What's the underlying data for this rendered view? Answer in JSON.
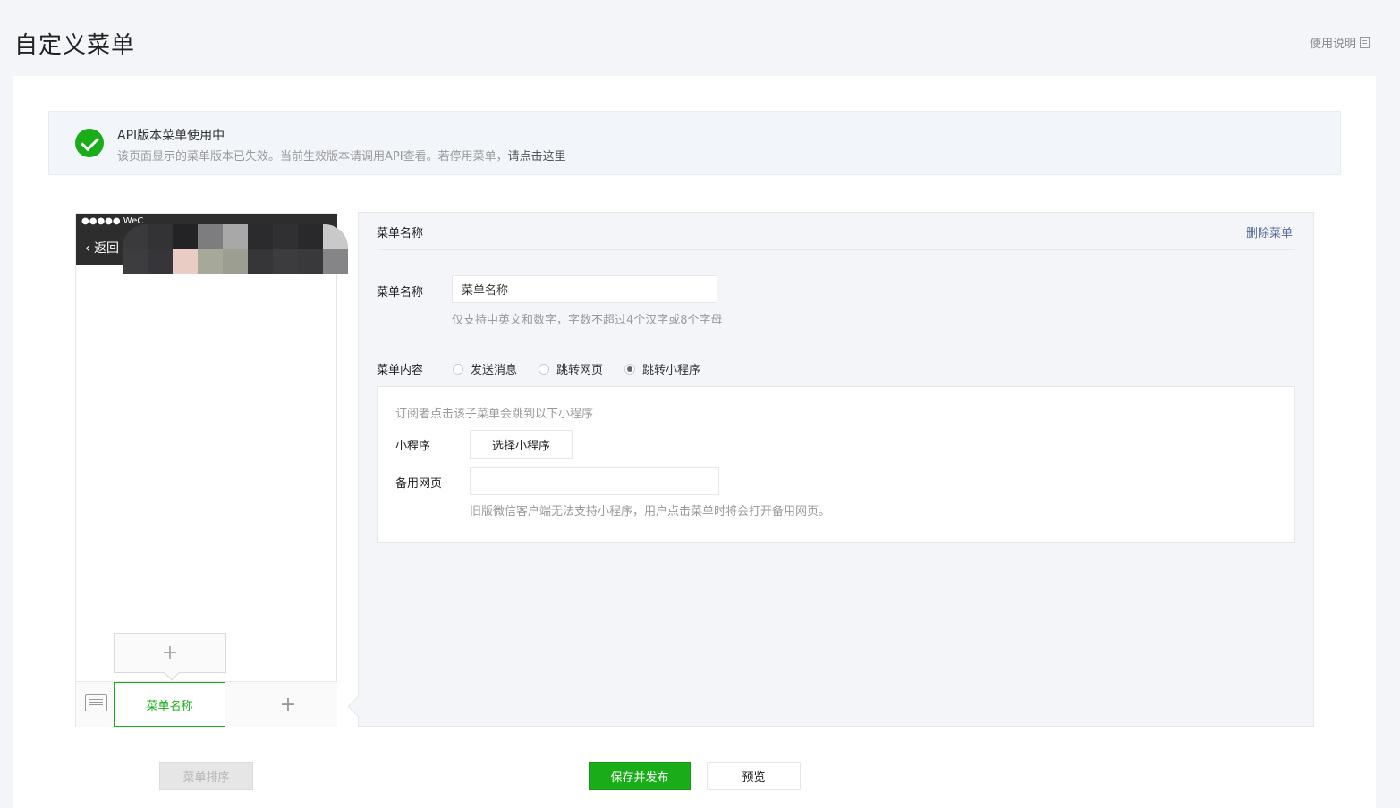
{
  "header": {
    "title": "自定义菜单",
    "help_label": "使用说明"
  },
  "notice": {
    "title": "API版本菜单使用中",
    "desc": "该页面显示的菜单版本已失效。当前生效版本请调用API查看。若停用菜单，",
    "link": "请点击这里"
  },
  "phone": {
    "status_text": "●●●●● WeC",
    "back_label": "返回",
    "add_submenu": "+",
    "menu_item_label": "菜单名称",
    "add_menu": "+"
  },
  "editor": {
    "header": "菜单名称",
    "delete_label": "删除菜单",
    "name_label": "菜单名称",
    "name_value": "菜单名称",
    "name_tip": "仅支持中英文和数字，字数不超过4个汉字或8个字母",
    "content_label": "菜单内容",
    "options": [
      "发送消息",
      "跳转网页",
      "跳转小程序"
    ],
    "selected_option": "跳转小程序",
    "miniprogram": {
      "tip": "订阅者点击该子菜单会跳到以下小程序",
      "mp_label": "小程序",
      "choose_button": "选择小程序",
      "backup_label": "备用网页",
      "backup_value": "",
      "note": "旧版微信客户端无法支持小程序，用户点击菜单时将会打开备用网页。"
    }
  },
  "actions": {
    "sort": "菜单排序",
    "publish": "保存并发布",
    "preview": "预览"
  },
  "colors": {
    "accent": "#1aad19",
    "link": "#576b95"
  }
}
